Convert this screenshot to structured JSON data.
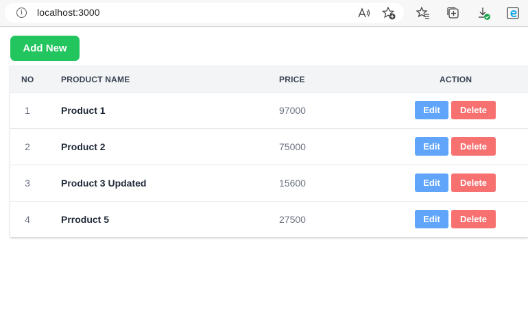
{
  "browser": {
    "url": "localhost:3000",
    "info_glyph": "i",
    "icons": [
      "info-icon",
      "read-aloud-icon",
      "add-favorite-icon",
      "favorites-icon",
      "collections-icon",
      "downloads-icon",
      "edge-icon"
    ]
  },
  "page": {
    "add_button_label": "Add New",
    "table": {
      "headers": {
        "no": "NO",
        "name": "PRODUCT NAME",
        "price": "PRICE",
        "action": "ACTION"
      },
      "rows": [
        {
          "no": "1",
          "name": "Product 1",
          "price": "97000"
        },
        {
          "no": "2",
          "name": "Product 2",
          "price": "75000"
        },
        {
          "no": "3",
          "name": "Product 3 Updated",
          "price": "15600"
        },
        {
          "no": "4",
          "name": "Prroduct 5",
          "price": "27500"
        }
      ],
      "edit_label": "Edit",
      "delete_label": "Delete"
    }
  },
  "colors": {
    "add_button": "#22c55e",
    "edit_button": "#60a5fa",
    "delete_button": "#f87171",
    "header_bg": "#f3f4f6"
  }
}
